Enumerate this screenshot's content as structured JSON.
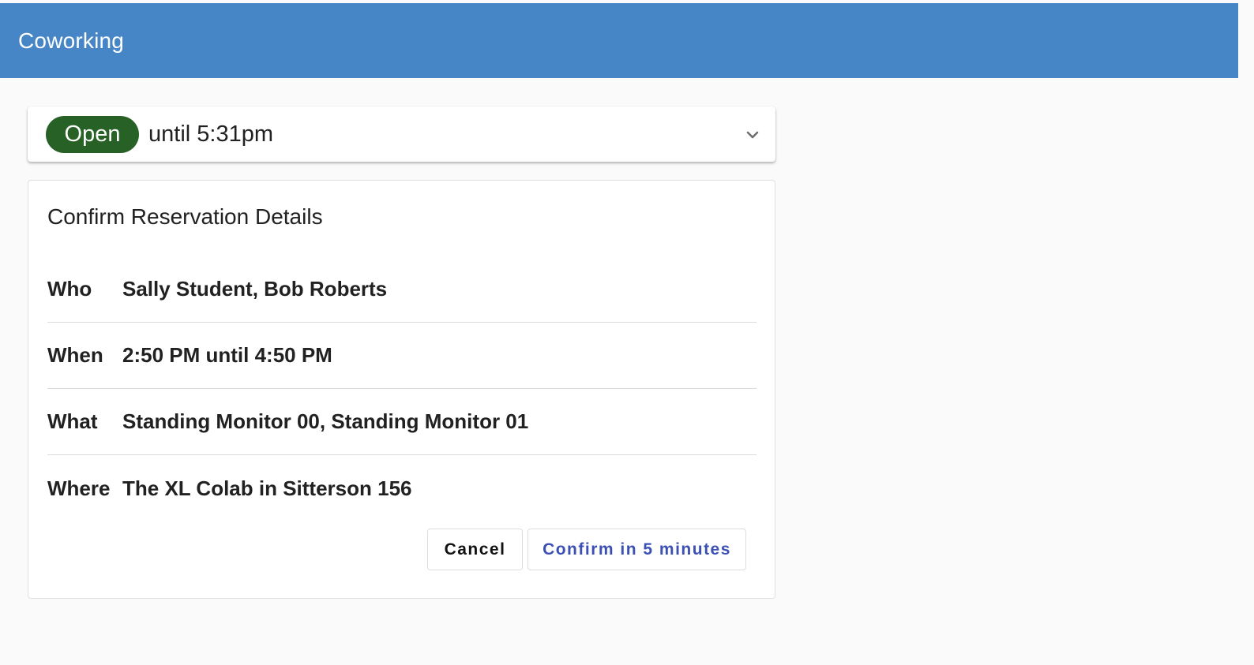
{
  "app": {
    "title": "Coworking",
    "header_color": "#4786c6"
  },
  "status": {
    "badge": "Open",
    "badge_color": "#276126",
    "text": "until 5:31pm",
    "expand_icon": "chevron-down-icon"
  },
  "reservation": {
    "title": "Confirm Reservation Details",
    "details": [
      {
        "label": "Who",
        "value": "Sally Student, Bob Roberts"
      },
      {
        "label": "When",
        "value": "2:50 PM until 4:50 PM"
      },
      {
        "label": "What",
        "value": "Standing Monitor 00, Standing Monitor 01"
      },
      {
        "label": "Where",
        "value": "The XL Colab in Sitterson 156"
      }
    ],
    "cancel_label": "Cancel",
    "confirm_label": "Confirm in 5 minutes",
    "confirm_color": "#3c50b4"
  }
}
